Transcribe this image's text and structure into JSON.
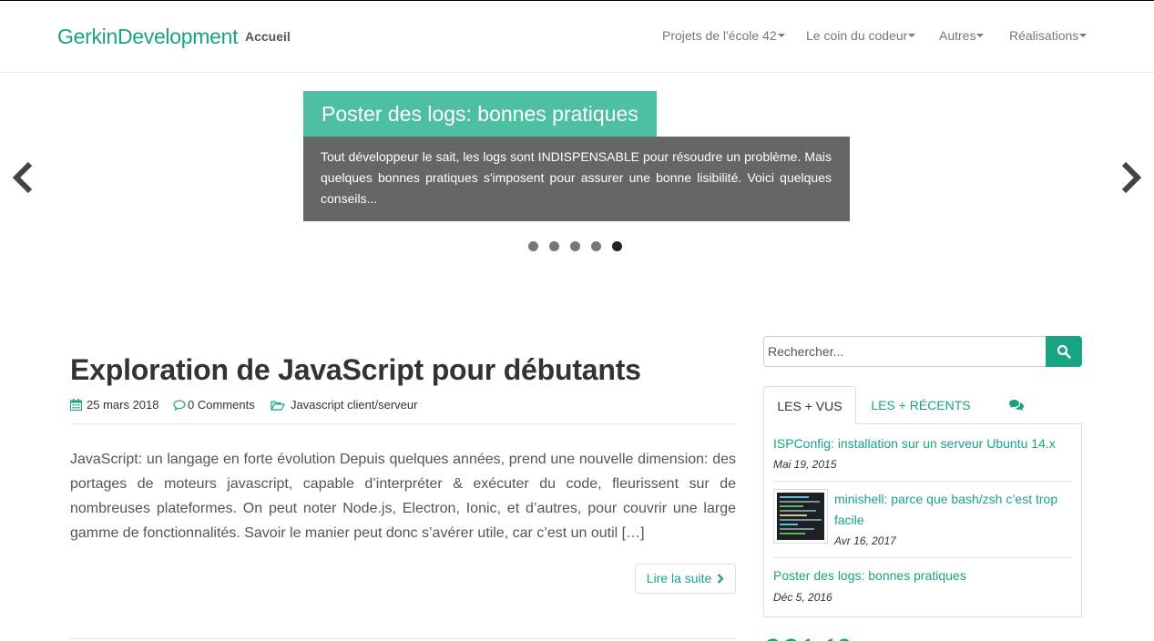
{
  "navbar": {
    "brand": "GerkinDevelopment",
    "home": "Accueil",
    "menu": [
      {
        "label": "Projets de l'école 42"
      },
      {
        "label": "Le coin du codeur"
      },
      {
        "label": "Autres"
      },
      {
        "label": "Réalisations"
      }
    ]
  },
  "carousel": {
    "title": "Poster des logs: bonnes pratiques",
    "text": "Tout développeur le sait, les logs sont INDISPENSABLE pour résoudre un problème. Mais quelques bonnes pratiques s'imposent pour assurer une bonne lisibilité. Voici quelques conseils...",
    "dot_count": 5,
    "active_index": 4,
    "icons": [
      "chevron-left-icon",
      "chevron-right-icon"
    ]
  },
  "post": {
    "title": "Exploration de JavaScript pour débutants",
    "date": "25 mars 2018",
    "comments": "0 Comments",
    "category": "Javascript client/serveur",
    "excerpt": "JavaScript: un langage en forte évolution Depuis quelques années,  prend une nouvelle dimension: des portages de moteurs javascript, capable d’interpréter & exécuter du code, fleurissent sur de nombreuses plateformes. On peut noter Node.js, Electron, Ionic, et d’autres, pour couvrir une large gamme de fonctionnalités. Savoir le manier peut donc s’avérer utile, car c’est un outil […]",
    "read_more": "Lire la suite"
  },
  "sidebar": {
    "search_placeholder": "Rechercher...",
    "tabs": [
      "LES + VUS",
      "LES + RÉCENTS"
    ],
    "items": [
      {
        "title": "ISPConfig: installation sur un serveur Ubuntu 14.x",
        "date": "Mai 19, 2015"
      },
      {
        "title": "minishell: parce que bash/zsh c’est trop facile",
        "date": "Avr 16, 2017"
      },
      {
        "title": "Poster des logs: bonnes pratiques",
        "date": "Déc 5, 2016"
      }
    ]
  },
  "colors": {
    "accent": "#18a383",
    "caption_title_bg": "#4dc0a3",
    "caption_body_bg": "#666666"
  }
}
